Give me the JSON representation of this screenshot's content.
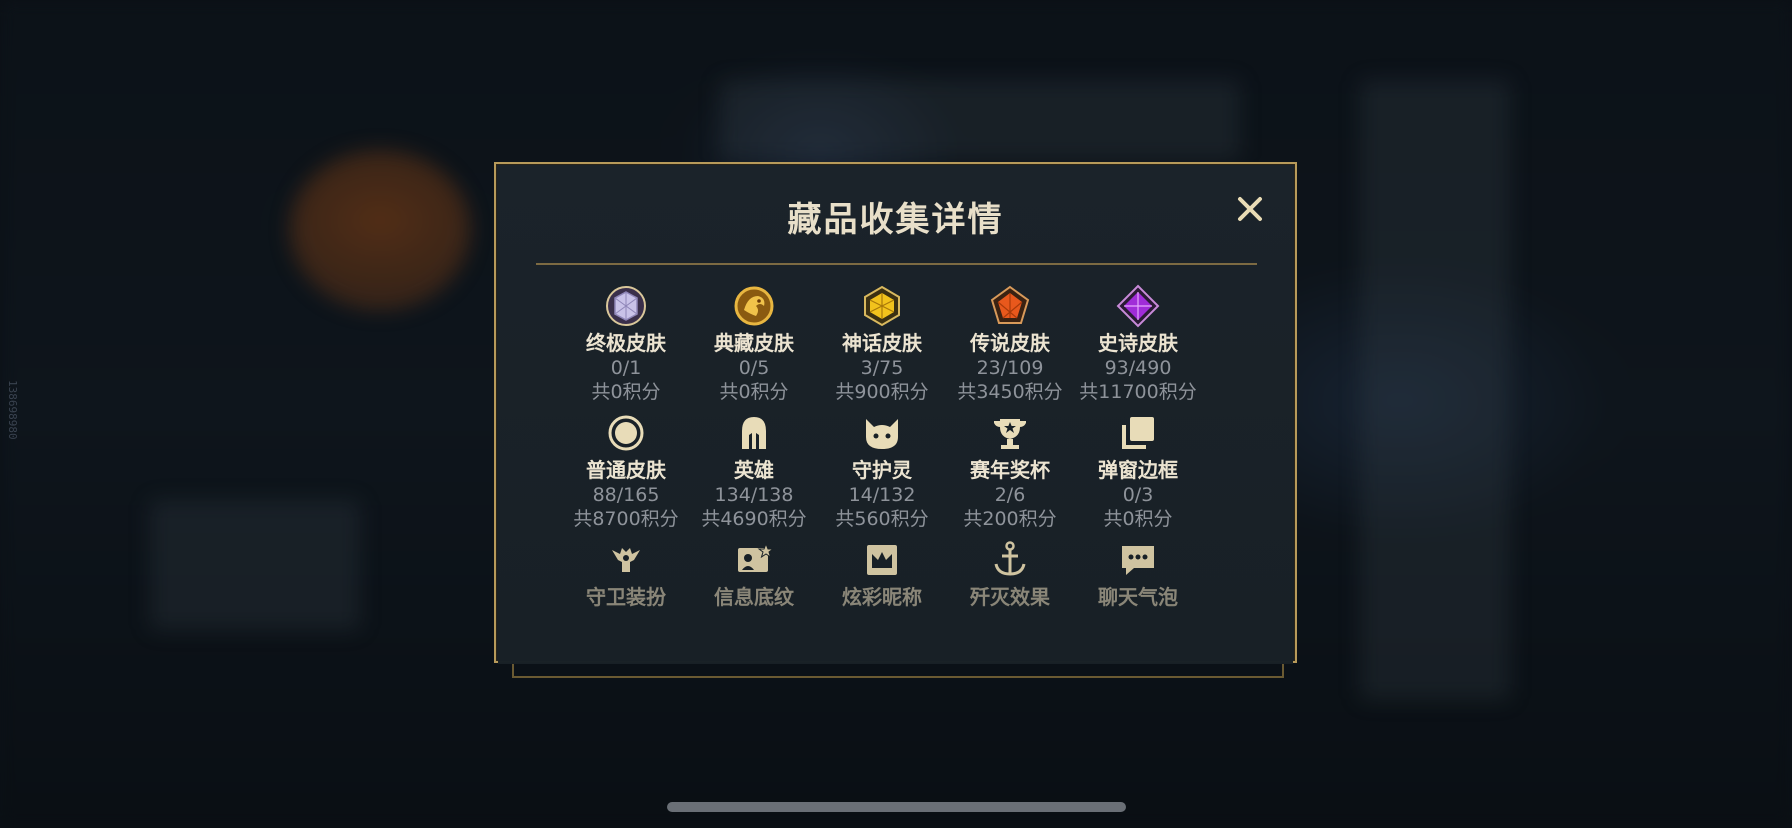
{
  "side_id": "138698980",
  "modal": {
    "title": "藏品收集详情",
    "close_label": "✕"
  },
  "colors": {
    "accent_gold": "#b79a5a",
    "icon_cream": "#e8dcb8",
    "text_primary": "#ece4d1",
    "text_secondary": "#8e939a"
  },
  "items": [
    {
      "name": "终极皮肤",
      "count": "0/1",
      "points": "共0积分",
      "icon": "ultimate-gem-icon"
    },
    {
      "name": "典藏皮肤",
      "count": "0/5",
      "points": "共0积分",
      "icon": "prestige-dragon-icon"
    },
    {
      "name": "神话皮肤",
      "count": "3/75",
      "points": "共900积分",
      "icon": "mythic-gem-icon"
    },
    {
      "name": "传说皮肤",
      "count": "23/109",
      "points": "共3450积分",
      "icon": "legendary-gem-icon"
    },
    {
      "name": "史诗皮肤",
      "count": "93/490",
      "points": "共11700积分",
      "icon": "epic-gem-icon"
    },
    {
      "name": "普通皮肤",
      "count": "88/165",
      "points": "共8700积分",
      "icon": "circle-icon"
    },
    {
      "name": "英雄",
      "count": "134/138",
      "points": "共4690积分",
      "icon": "helmet-icon"
    },
    {
      "name": "守护灵",
      "count": "14/132",
      "points": "共560积分",
      "icon": "little-legend-icon"
    },
    {
      "name": "赛年奖杯",
      "count": "2/6",
      "points": "共200积分",
      "icon": "trophy-icon"
    },
    {
      "name": "弹窗边框",
      "count": "0/3",
      "points": "共0积分",
      "icon": "frame-icon"
    },
    {
      "name": "守卫装扮",
      "icon": "ward-icon"
    },
    {
      "name": "信息底纹",
      "icon": "banner-icon"
    },
    {
      "name": "炫彩昵称",
      "icon": "crown-icon"
    },
    {
      "name": "歼灭效果",
      "icon": "anchor-icon"
    },
    {
      "name": "聊天气泡",
      "icon": "chat-bubble-icon"
    }
  ]
}
